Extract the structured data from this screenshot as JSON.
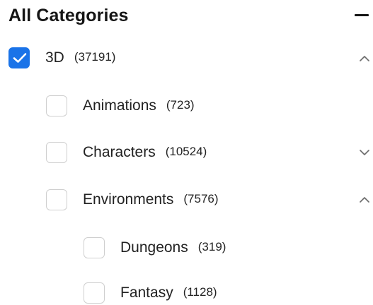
{
  "panel": {
    "title": "All Categories",
    "collapse_icon": "minus-icon"
  },
  "categories": [
    {
      "label": "3D",
      "count": "(37191)",
      "checked": true,
      "expander": "chevron-up-icon"
    },
    {
      "label": "Animations",
      "count": "(723)",
      "checked": false,
      "expander": null
    },
    {
      "label": "Characters",
      "count": "(10524)",
      "checked": false,
      "expander": "chevron-down-icon"
    },
    {
      "label": "Environments",
      "count": "(7576)",
      "checked": false,
      "expander": "chevron-up-icon"
    },
    {
      "label": "Dungeons",
      "count": "(319)",
      "checked": false,
      "expander": null
    },
    {
      "label": "Fantasy",
      "count": "(1128)",
      "checked": false,
      "expander": null
    }
  ],
  "colors": {
    "accent": "#1a73e8",
    "checkbox_border": "#cfcfcf",
    "text": "#222222"
  }
}
